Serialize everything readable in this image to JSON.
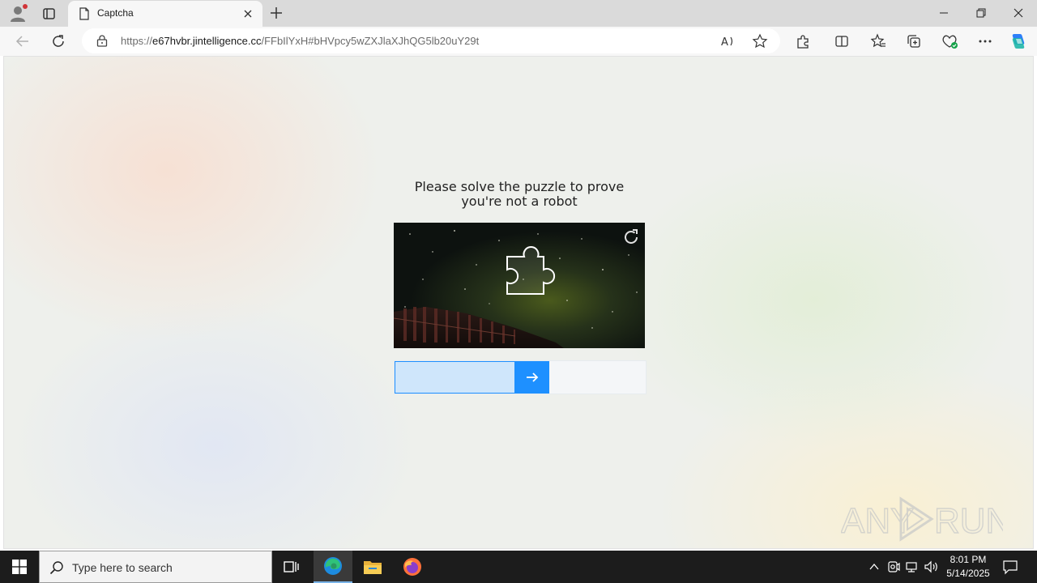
{
  "browser": {
    "tab_title": "Captcha",
    "url_scheme": "https://",
    "url_host": "e67hvbr.jintelligence.cc",
    "url_path": "/FFbIlYxH#bHVpcy5wZXJlaXJhQG5lb20uY29t"
  },
  "captcha": {
    "prompt_line1": "Please solve the puzzle to prove",
    "prompt_line2": "you're not a robot",
    "slider_progress_percent": 48,
    "accent_color": "#1e90ff"
  },
  "taskbar": {
    "search_placeholder": "Type here to search",
    "time": "8:01 PM",
    "date": "5/14/2025"
  },
  "watermark": {
    "left": "ANY",
    "right": "RUN"
  },
  "icons": {
    "browser": [
      "profile-icon",
      "tab-actions-icon",
      "page-icon",
      "close-icon",
      "plus-icon",
      "minimize-icon",
      "restore-icon",
      "back-icon",
      "refresh-icon",
      "lock-icon",
      "read-aloud-icon",
      "star-icon",
      "extensions-icon",
      "split-screen-icon",
      "favorites-icon",
      "collections-icon",
      "browser-essentials-icon",
      "more-icon",
      "copilot-icon"
    ],
    "page": [
      "puzzle-piece-icon",
      "refresh-puzzle-icon",
      "arrow-right-icon"
    ],
    "taskbar": [
      "windows-icon",
      "search-icon",
      "task-view-icon",
      "edge-icon",
      "file-explorer-icon",
      "firefox-icon",
      "chevron-up-icon",
      "meet-icon",
      "network-icon",
      "volume-icon",
      "notification-icon"
    ]
  }
}
